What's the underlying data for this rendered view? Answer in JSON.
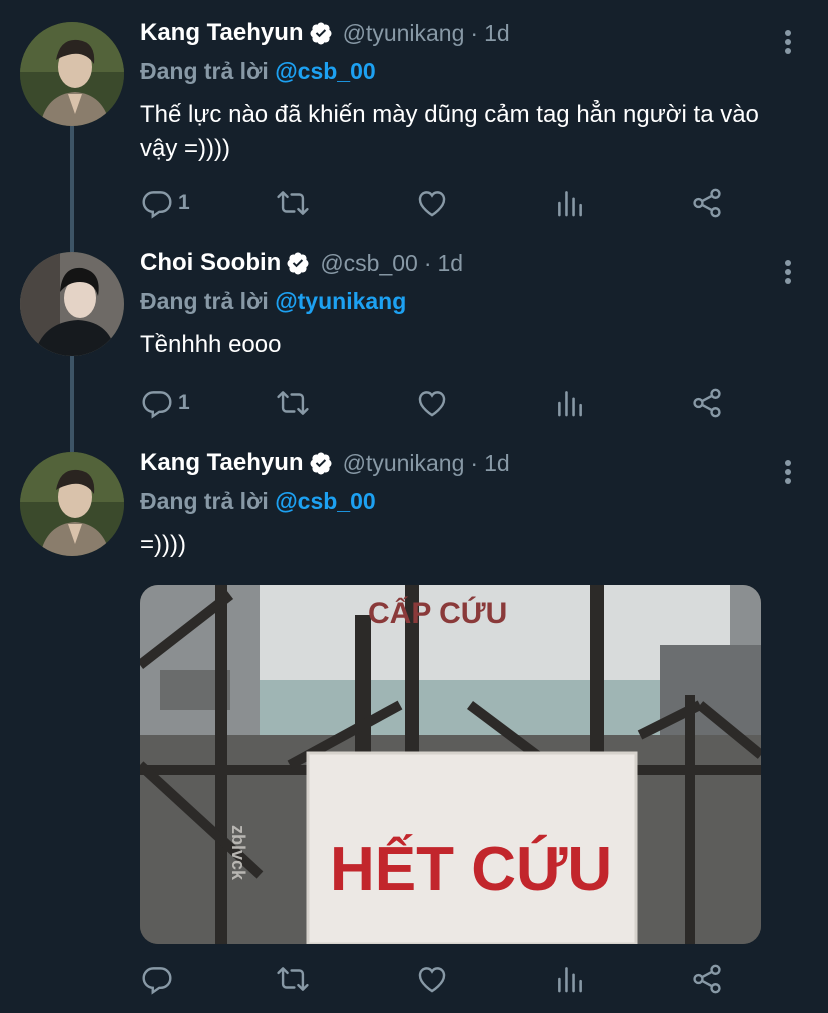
{
  "colors": {
    "background": "#15202b",
    "secondary_text": "#8899a6",
    "mention": "#1da1f2",
    "verified_badge": "#ffffff",
    "thread_line": "#3d5466"
  },
  "tweets": [
    {
      "name": "Kang Taehyun",
      "handle": "@tyunikang",
      "separator": "·",
      "time": "1d",
      "replying_prefix": "Đang trả lời",
      "replying_to": "@csb_00",
      "text": "Thế lực nào đã khiến mày dũng cảm tag hẳn người ta vào vậy =))))",
      "reply_count": "1",
      "icons": [
        "reply-icon",
        "retweet-icon",
        "like-icon",
        "analytics-icon",
        "share-icon"
      ]
    },
    {
      "name": "Choi Soobin",
      "handle": "@csb_00",
      "separator": "·",
      "time": "1d",
      "replying_prefix": "Đang trả lời",
      "replying_to": "@tyunikang",
      "text": "Tềnhhh eooo",
      "reply_count": "1",
      "icons": [
        "reply-icon",
        "retweet-icon",
        "like-icon",
        "analytics-icon",
        "share-icon"
      ]
    },
    {
      "name": "Kang Taehyun",
      "handle": "@tyunikang",
      "separator": "·",
      "time": "1d",
      "replying_prefix": "Đang trả lời",
      "replying_to": "@csb_00",
      "text": "=))))",
      "reply_count": "",
      "media": {
        "sign_top": "CẤP CỨU",
        "sign_main": "HẾT CỨU",
        "watermark": "zblvck"
      },
      "icons": [
        "reply-icon",
        "retweet-icon",
        "like-icon",
        "analytics-icon",
        "share-icon"
      ]
    }
  ]
}
